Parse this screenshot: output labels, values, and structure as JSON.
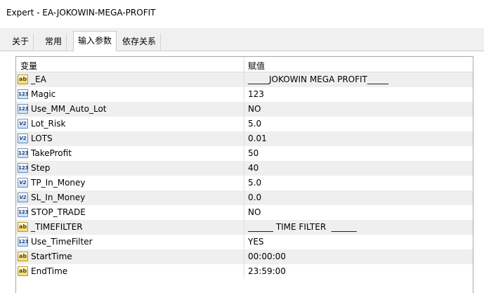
{
  "window": {
    "title": "Expert - EA-JOKOWIN-MEGA-PROFIT"
  },
  "tabs": [
    {
      "label": "关于"
    },
    {
      "label": "常用"
    },
    {
      "label": "输入参数"
    },
    {
      "label": "依存关系"
    }
  ],
  "grid": {
    "col_variable": "变量",
    "col_value": "赋值",
    "rows": [
      {
        "icon": "ab",
        "name": "_EA",
        "value": "_____JOKOWIN MEGA PROFIT_____"
      },
      {
        "icon": "123",
        "name": "Magic",
        "value": "123"
      },
      {
        "icon": "123",
        "name": "Use_MM_Auto_Lot",
        "value": "NO"
      },
      {
        "icon": "V2",
        "name": "Lot_Risk",
        "value": "5.0"
      },
      {
        "icon": "V2",
        "name": "LOTS",
        "value": "0.01"
      },
      {
        "icon": "123",
        "name": "TakeProfit",
        "value": "50"
      },
      {
        "icon": "123",
        "name": "Step",
        "value": "40"
      },
      {
        "icon": "V2",
        "name": "TP_In_Money",
        "value": "5.0"
      },
      {
        "icon": "V2",
        "name": "SL_In_Money",
        "value": "0.0"
      },
      {
        "icon": "123",
        "name": "STOP_TRADE",
        "value": "NO"
      },
      {
        "icon": "ab",
        "name": "_TIMEFILTER",
        "value": "______ TIME FILTER  ______"
      },
      {
        "icon": "123",
        "name": "Use_TimeFilter",
        "value": "YES"
      },
      {
        "icon": "ab",
        "name": "StartTime",
        "value": "00:00:00"
      },
      {
        "icon": "ab",
        "name": "EndTime",
        "value": "23:59:00"
      }
    ]
  }
}
